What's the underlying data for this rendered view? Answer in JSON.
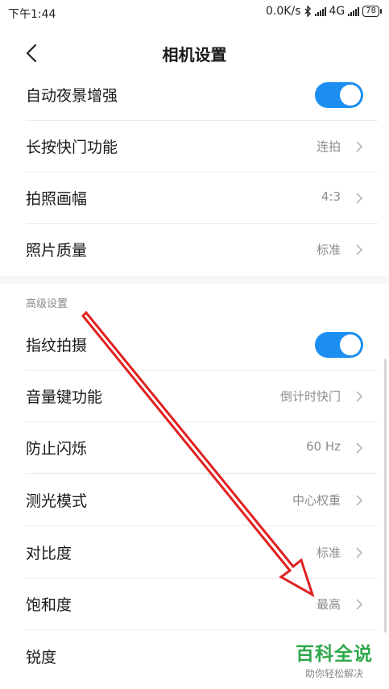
{
  "status": {
    "time": "下午1:44",
    "speed": "0.0K/s",
    "network": "4G",
    "battery": "78"
  },
  "header": {
    "title": "相机设置"
  },
  "basic_rows": [
    {
      "label": "自动夜景增强",
      "value": "",
      "toggle": true
    },
    {
      "label": "长按快门功能",
      "value": "连拍"
    },
    {
      "label": "拍照画幅",
      "value": "4:3"
    },
    {
      "label": "照片质量",
      "value": "标准"
    }
  ],
  "advanced": {
    "title": "高级设置",
    "rows": [
      {
        "label": "指纹拍摄",
        "value": "",
        "toggle": true
      },
      {
        "label": "音量键功能",
        "value": "倒计时快门"
      },
      {
        "label": "防止闪烁",
        "value": "60 Hz"
      },
      {
        "label": "测光模式",
        "value": "中心权重"
      },
      {
        "label": "对比度",
        "value": "标准"
      },
      {
        "label": "饱和度",
        "value": "最高"
      },
      {
        "label": "锐度",
        "value": ""
      }
    ]
  },
  "watermark": {
    "main": "百科全说",
    "sub": "助你轻松解决"
  },
  "colors": {
    "accent": "#1c8ef0",
    "arrow": "#e02020",
    "watermark": "#2ea84a"
  },
  "icons": [
    "back-arrow-icon",
    "bluetooth-icon",
    "signal-icon",
    "chevron-right-icon",
    "annotation-arrow-icon"
  ]
}
